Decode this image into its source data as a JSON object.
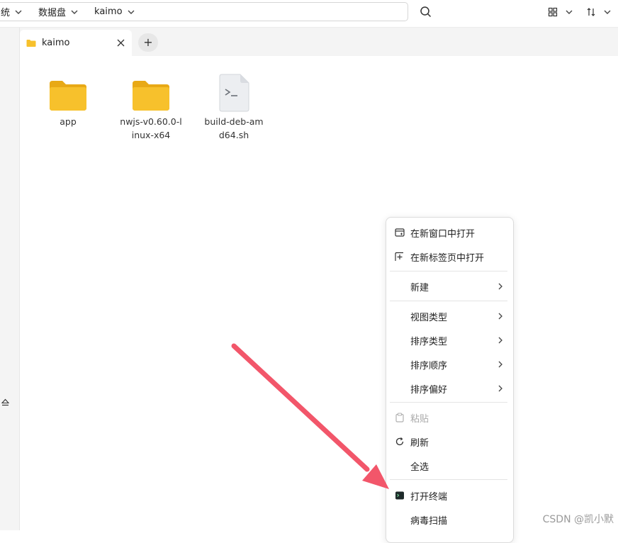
{
  "breadcrumb": [
    {
      "label": "统"
    },
    {
      "label": "数据盘"
    },
    {
      "label": "kaimo"
    }
  ],
  "toolbar": {
    "search_icon": "search-icon",
    "view_icon": "grid-view-icon",
    "sort_icon": "sort-icon"
  },
  "tabs": [
    {
      "label": "kaimo",
      "icon": "folder-icon"
    }
  ],
  "new_tab_label": "+",
  "files": [
    {
      "name": "app",
      "type": "folder"
    },
    {
      "name": "nwjs-v0.60.0-linux-x64",
      "type": "folder"
    },
    {
      "name": "build-deb-amd64.sh",
      "type": "script"
    }
  ],
  "context_menu": {
    "items": [
      {
        "label": "在新窗口中打开",
        "icon": "new-window-icon"
      },
      {
        "label": "在新标签页中打开",
        "icon": "new-tab-icon"
      },
      {
        "label": "新建",
        "submenu": true
      },
      {
        "label": "视图类型",
        "submenu": true
      },
      {
        "label": "排序类型",
        "submenu": true
      },
      {
        "label": "排序顺序",
        "submenu": true
      },
      {
        "label": "排序偏好",
        "submenu": true
      },
      {
        "label": "粘贴",
        "icon": "paste-icon",
        "disabled": true
      },
      {
        "label": "刷新",
        "icon": "refresh-icon"
      },
      {
        "label": "全选"
      },
      {
        "label": "打开终端",
        "icon": "terminal-icon"
      },
      {
        "label": "病毒扫描"
      }
    ]
  },
  "watermark": "CSDN @凯小默",
  "colors": {
    "folder": "#f7c12c",
    "folder_dark": "#e8a916",
    "arrow": "#f2566a"
  }
}
